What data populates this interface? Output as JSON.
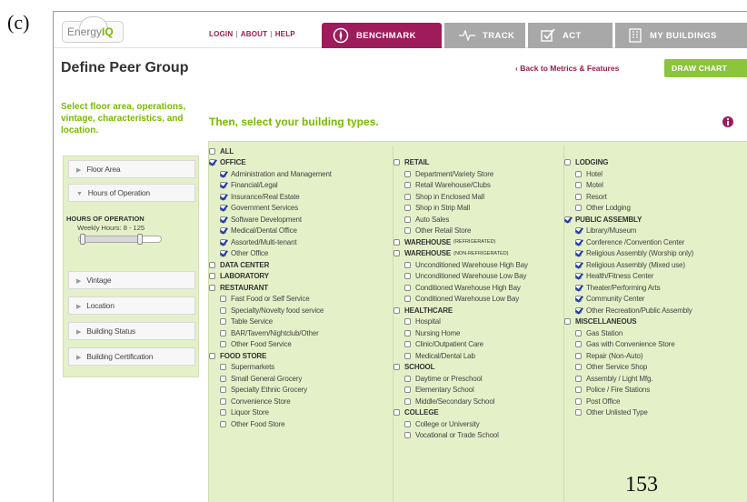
{
  "figure_label": "(c)",
  "page_number": "153",
  "nav": {
    "logo": {
      "prefix": "Energy",
      "suffix": "IQ"
    },
    "links": [
      "LOGIN",
      "ABOUT",
      "HELP"
    ],
    "tabs": [
      {
        "label": "BENCHMARK",
        "icon": "compass-icon",
        "active": true
      },
      {
        "label": "TRACK",
        "icon": "pulse-icon",
        "active": false
      },
      {
        "label": "ACT",
        "icon": "checkbox-icon",
        "active": false
      },
      {
        "label": "MY BUILDINGS",
        "icon": "building-icon",
        "active": false
      }
    ]
  },
  "header": {
    "title": "Define Peer Group",
    "back_link": "‹ Back to Metrics & Features",
    "draw_button": "DRAW CHART"
  },
  "sidebar": {
    "intro": "Select floor area, operations, vintage, characteristics, and location.",
    "items": [
      "Floor Area",
      "Hours of Operation",
      "Vintage",
      "Location",
      "Building Status",
      "Building Certification"
    ],
    "expanded_panel": {
      "title": "HOURS OF OPERATION",
      "subtitle": "Weekly Hours: 8 - 125",
      "slider_range": [
        8,
        125
      ],
      "slider_min": 0,
      "slider_max": 168
    }
  },
  "main": {
    "heading": "Then, select your building types.",
    "columns": [
      [
        {
          "label": "ALL",
          "level": 0,
          "checked": false
        },
        {
          "label": "OFFICE",
          "level": 0,
          "checked": true
        },
        {
          "label": "Administration and Management",
          "level": 1,
          "checked": true
        },
        {
          "label": "Financial/Legal",
          "level": 1,
          "checked": true
        },
        {
          "label": "Insurance/Real Estate",
          "level": 1,
          "checked": true
        },
        {
          "label": "Government Services",
          "level": 1,
          "checked": true
        },
        {
          "label": "Software Development",
          "level": 1,
          "checked": true
        },
        {
          "label": "Medical/Dental Office",
          "level": 1,
          "checked": true
        },
        {
          "label": "Assorted/Multi-tenant",
          "level": 1,
          "checked": true
        },
        {
          "label": "Other Office",
          "level": 1,
          "checked": true
        },
        {
          "label": "DATA CENTER",
          "level": 0,
          "checked": false
        },
        {
          "label": "LABORATORY",
          "level": 0,
          "checked": false
        },
        {
          "label": "RESTAURANT",
          "level": 0,
          "checked": false
        },
        {
          "label": "Fast Food or Self Service",
          "level": 1,
          "checked": false
        },
        {
          "label": "Specialty/Novelty food service",
          "level": 1,
          "checked": false
        },
        {
          "label": "Table Service",
          "level": 1,
          "checked": false
        },
        {
          "label": "BAR/Tavern/Nightclub/Other",
          "level": 1,
          "checked": false
        },
        {
          "label": "Other Food Service",
          "level": 1,
          "checked": false
        },
        {
          "label": "FOOD STORE",
          "level": 0,
          "checked": false
        },
        {
          "label": "Supermarkets",
          "level": 1,
          "checked": false
        },
        {
          "label": "Small General Grocery",
          "level": 1,
          "checked": false
        },
        {
          "label": "Specialty Ethnic Grocery",
          "level": 1,
          "checked": false
        },
        {
          "label": "Convenience Store",
          "level": 1,
          "checked": false
        },
        {
          "label": "Liquor Store",
          "level": 1,
          "checked": false
        },
        {
          "label": "Other Food Store",
          "level": 1,
          "checked": false
        }
      ],
      [
        {
          "label": "",
          "level": 0,
          "spacer": true
        },
        {
          "label": "RETAIL",
          "level": 0,
          "checked": false
        },
        {
          "label": "Department/Variety Store",
          "level": 1,
          "checked": false
        },
        {
          "label": "Retail Warehouse/Clubs",
          "level": 1,
          "checked": false
        },
        {
          "label": "Shop in Enclosed Mall",
          "level": 1,
          "checked": false
        },
        {
          "label": "Shop in Strip Mall",
          "level": 1,
          "checked": false
        },
        {
          "label": "Auto Sales",
          "level": 1,
          "checked": false
        },
        {
          "label": "Other Retail Store",
          "level": 1,
          "checked": false
        },
        {
          "label": "WAREHOUSE",
          "note": "(REFRIGERATED)",
          "level": 0,
          "checked": false
        },
        {
          "label": "WAREHOUSE",
          "note": "(NON-REFRIGERATED)",
          "level": 0,
          "checked": false
        },
        {
          "label": "Unconditioned Warehouse High Bay",
          "level": 1,
          "checked": false
        },
        {
          "label": "Unconditioned Warehouse Low Bay",
          "level": 1,
          "checked": false
        },
        {
          "label": "Conditioned Warehouse High Bay",
          "level": 1,
          "checked": false
        },
        {
          "label": "Conditioned Warehouse Low Bay",
          "level": 1,
          "checked": false
        },
        {
          "label": "HEALTHCARE",
          "level": 0,
          "checked": false
        },
        {
          "label": "Hospital",
          "level": 1,
          "checked": false
        },
        {
          "label": "Nursing Home",
          "level": 1,
          "checked": false
        },
        {
          "label": "Clinic/Outpatient Care",
          "level": 1,
          "checked": false
        },
        {
          "label": "Medical/Dental Lab",
          "level": 1,
          "checked": false
        },
        {
          "label": "SCHOOL",
          "level": 0,
          "checked": false
        },
        {
          "label": "Daytime or Preschool",
          "level": 1,
          "checked": false
        },
        {
          "label": "Elementary School",
          "level": 1,
          "checked": false
        },
        {
          "label": "Middle/Secondary School",
          "level": 1,
          "checked": false
        },
        {
          "label": "COLLEGE",
          "level": 0,
          "checked": false
        },
        {
          "label": "College or University",
          "level": 1,
          "checked": false
        },
        {
          "label": "Vocational or Trade School",
          "level": 1,
          "checked": false
        }
      ],
      [
        {
          "label": "",
          "level": 0,
          "spacer": true
        },
        {
          "label": "LODGING",
          "level": 0,
          "checked": false
        },
        {
          "label": "Hotel",
          "level": 1,
          "checked": false
        },
        {
          "label": "Motel",
          "level": 1,
          "checked": false
        },
        {
          "label": "Resort",
          "level": 1,
          "checked": false
        },
        {
          "label": "Other Lodging",
          "level": 1,
          "checked": false
        },
        {
          "label": "PUBLIC ASSEMBLY",
          "level": 0,
          "checked": true
        },
        {
          "label": "Library/Museum",
          "level": 1,
          "checked": true
        },
        {
          "label": "Conference /Convention Center",
          "level": 1,
          "checked": true
        },
        {
          "label": "Religious Assembly (Worship only)",
          "level": 1,
          "checked": true
        },
        {
          "label": "Religious Assembly (Mixed use)",
          "level": 1,
          "checked": true
        },
        {
          "label": "Health/Fitness Center",
          "level": 1,
          "checked": true
        },
        {
          "label": "Theater/Performing Arts",
          "level": 1,
          "checked": true
        },
        {
          "label": "Community Center",
          "level": 1,
          "checked": true
        },
        {
          "label": "Other Recreation/Public Assembly",
          "level": 1,
          "checked": true
        },
        {
          "label": "MISCELLANEOUS",
          "level": 0,
          "checked": false
        },
        {
          "label": "Gas Station",
          "level": 1,
          "checked": false
        },
        {
          "label": "Gas with Convenience Store",
          "level": 1,
          "checked": false
        },
        {
          "label": "Repair (Non-Auto)",
          "level": 1,
          "checked": false
        },
        {
          "label": "Other Service Shop",
          "level": 1,
          "checked": false
        },
        {
          "label": "Assembly / Light Mfg.",
          "level": 1,
          "checked": false
        },
        {
          "label": "Police / Fire Stations",
          "level": 1,
          "checked": false
        },
        {
          "label": "Post Office",
          "level": 1,
          "checked": false
        },
        {
          "label": "Other Unlisted Type",
          "level": 1,
          "checked": false
        }
      ]
    ]
  },
  "colors": {
    "brand_magenta": "#9e1b5c",
    "brand_green": "#7ab800",
    "panel_green": "#e4f0c8",
    "button_green": "#8cc43c",
    "inactive_tab": "#a8a8a8"
  }
}
